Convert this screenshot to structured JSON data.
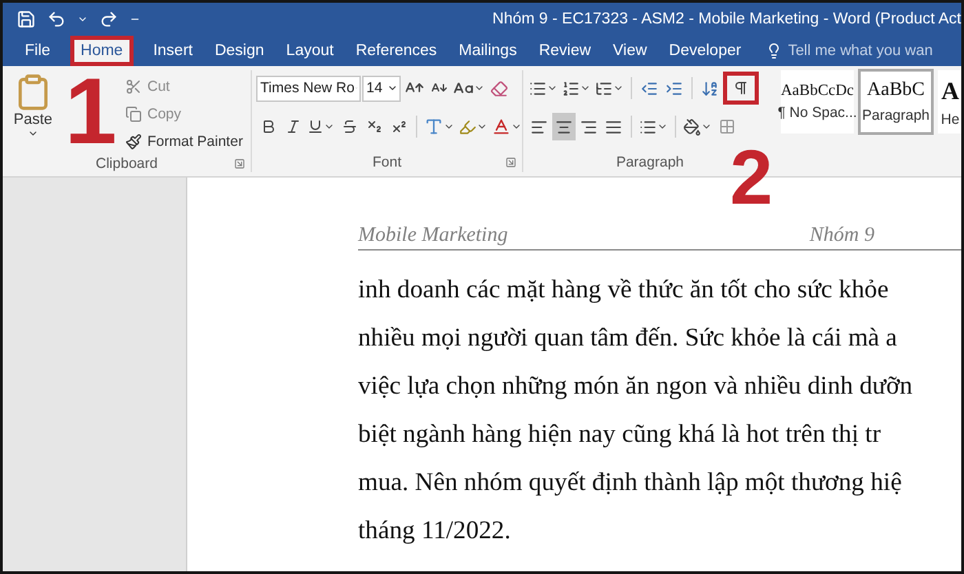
{
  "title_bar": {
    "title": "Nhóm 9 - EC17323 - ASM2 - Mobile Marketing - Word (Product Act"
  },
  "tabs": [
    {
      "label": "File",
      "selected": false,
      "highlighted": false
    },
    {
      "label": "Home",
      "selected": true,
      "highlighted": true
    },
    {
      "label": "Insert",
      "selected": false,
      "highlighted": false
    },
    {
      "label": "Design",
      "selected": false,
      "highlighted": false
    },
    {
      "label": "Layout",
      "selected": false,
      "highlighted": false
    },
    {
      "label": "References",
      "selected": false,
      "highlighted": false
    },
    {
      "label": "Mailings",
      "selected": false,
      "highlighted": false
    },
    {
      "label": "Review",
      "selected": false,
      "highlighted": false
    },
    {
      "label": "View",
      "selected": false,
      "highlighted": false
    },
    {
      "label": "Developer",
      "selected": false,
      "highlighted": false
    }
  ],
  "tell_me": {
    "placeholder": "Tell me what you wan"
  },
  "clipboard": {
    "paste": "Paste",
    "group_label": "Clipboard",
    "items": [
      {
        "kind": "cut",
        "label": "Cut"
      },
      {
        "kind": "copy",
        "label": "Copy"
      },
      {
        "kind": "painter",
        "label": "Format Painter"
      }
    ]
  },
  "font": {
    "font_name": "Times New Ro",
    "font_size": "14",
    "group_label": "Font"
  },
  "paragraph": {
    "group_label": "Paragraph",
    "show_marks": {
      "highlighted": true
    },
    "align_buttons": [
      {
        "kind": "left",
        "selected": false
      },
      {
        "kind": "center",
        "selected": true
      },
      {
        "kind": "right",
        "selected": false
      },
      {
        "kind": "justify",
        "selected": false
      }
    ]
  },
  "styles": [
    {
      "preview": "AaBbCcDc",
      "name": "¶ No Spac...",
      "selected": false
    },
    {
      "preview": "AaBbC",
      "name": "Paragraph",
      "selected": true
    },
    {
      "preview": "A",
      "name": "He",
      "selected": false
    }
  ],
  "document": {
    "header_left": "Mobile Marketing",
    "header_right": "Nhóm 9",
    "lines": [
      "inh doanh các mặt hàng về thức ăn tốt cho sức khỏe",
      "nhiều mọi người quan tâm đến. Sức khỏe là cái mà a",
      "việc lựa chọn những món ăn ngon và nhiều dinh dưỡn",
      "biệt ngành hàng hiện nay cũng khá là hot trên thị tr",
      "mua. Nên nhóm quyết định thành lập một thương hiệ",
      "tháng 11/2022."
    ]
  },
  "callouts": [
    {
      "label": "1"
    },
    {
      "label": "2"
    }
  ]
}
